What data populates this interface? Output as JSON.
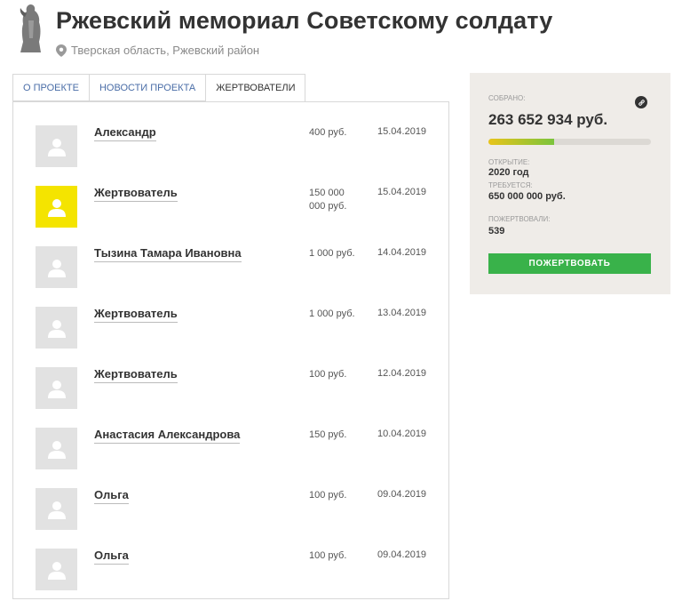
{
  "project": {
    "title": "Ржевский мемориал Советскому солдату",
    "location": "Тверская область, Ржевский район"
  },
  "tabs": [
    {
      "label": "О ПРОЕКТЕ",
      "active": false
    },
    {
      "label": "НОВОСТИ ПРОЕКТА",
      "active": false
    },
    {
      "label": "ЖЕРТВОВАТЕЛИ",
      "active": true
    }
  ],
  "donors": [
    {
      "name": "Александр",
      "amount": "400 руб.",
      "date": "15.04.2019",
      "avatar": "default"
    },
    {
      "name": "Жертвователь",
      "amount": "150 000 000 руб.",
      "date": "15.04.2019",
      "avatar": "yellow"
    },
    {
      "name": "Тызина Тамара Ивановна",
      "amount": "1 000 руб.",
      "date": "14.04.2019",
      "avatar": "default"
    },
    {
      "name": "Жертвователь",
      "amount": "1 000 руб.",
      "date": "13.04.2019",
      "avatar": "default"
    },
    {
      "name": "Жертвователь",
      "amount": "100 руб.",
      "date": "12.04.2019",
      "avatar": "default"
    },
    {
      "name": "Анастасия Александрова",
      "amount": "150 руб.",
      "date": "10.04.2019",
      "avatar": "default"
    },
    {
      "name": "Ольга",
      "amount": "100 руб.",
      "date": "09.04.2019",
      "avatar": "default"
    },
    {
      "name": "Ольга",
      "amount": "100 руб.",
      "date": "09.04.2019",
      "avatar": "default"
    }
  ],
  "sidebar": {
    "collected_label": "СОБРАНО:",
    "collected_value": "263 652 934 руб.",
    "progress_fraction": 0.406,
    "opened_label": "ОТКРЫТИЕ:",
    "opened_value": "2020 год",
    "required_label": "ТРЕБУЕТСЯ:",
    "required_value": "650 000 000 руб.",
    "donated_label": "ПОЖЕРТВОВАЛИ:",
    "donated_value": "539",
    "donate_button": "ПОЖЕРТВОВАТЬ",
    "link_icon": "link-icon"
  },
  "colors": {
    "accent_green": "#39b24a",
    "tab_link": "#4a6da7",
    "highlight_avatar": "#f4e400",
    "sidebar_bg": "#efece8"
  }
}
